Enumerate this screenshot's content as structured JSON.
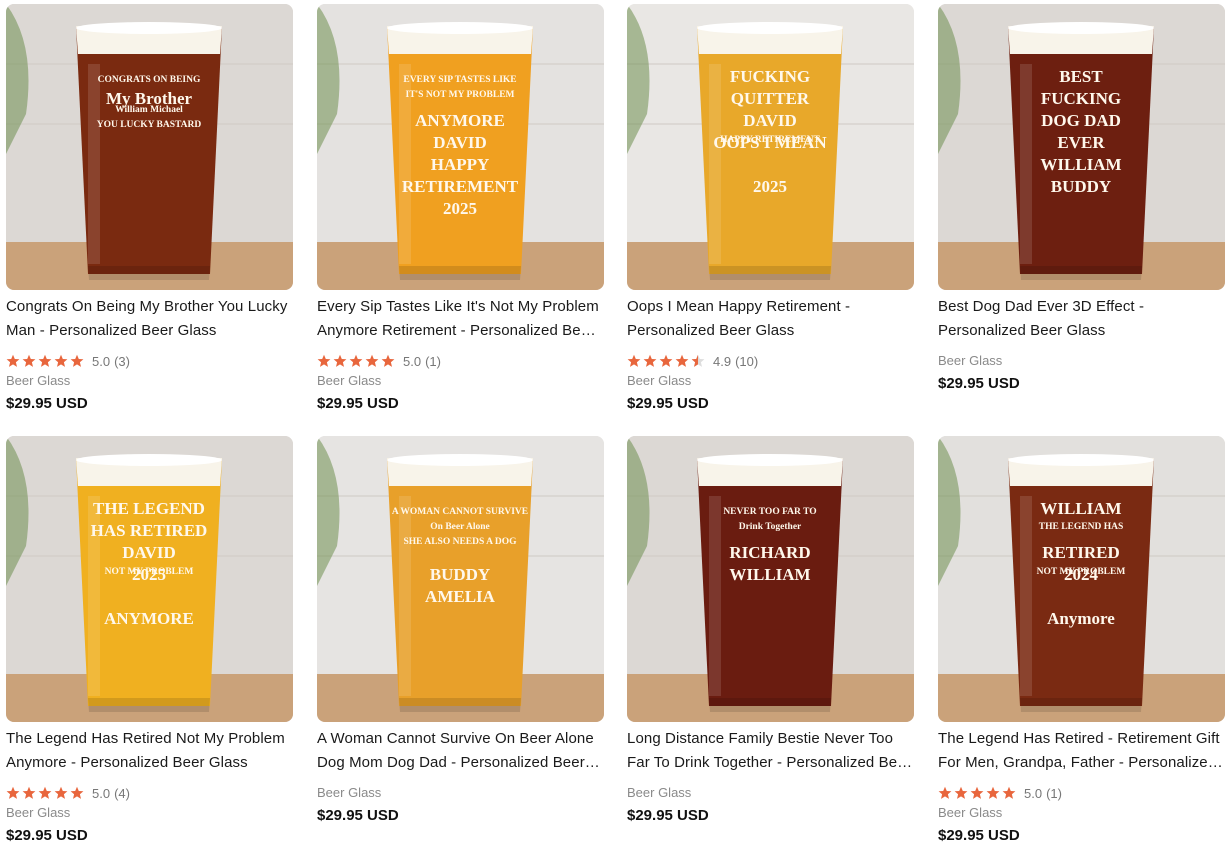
{
  "currency_suffix": "USD",
  "products": [
    {
      "title": "Congrats On Being My Brother You Lucky Man - Personalized Beer Glass",
      "rating": "5.0",
      "reviews": "(3)",
      "stars": 5,
      "category": "Beer Glass",
      "price": "$29.95 USD",
      "image": {
        "icon": "pint-glass-image",
        "beer": "#7a2a10",
        "bg": "#dcd8d4",
        "text": [
          "CONGRATS ON BEING",
          "My Brother",
          "William   Michael",
          "YOU LUCKY BASTARD"
        ]
      }
    },
    {
      "title": "Every Sip Tastes Like It's Not My Problem Anymore Retirement - Personalized Beer Glass",
      "rating": "5.0",
      "reviews": "(1)",
      "stars": 5,
      "category": "Beer Glass",
      "price": "$29.95 USD",
      "image": {
        "icon": "pint-glass-image",
        "beer": "#f0a020",
        "bg": "#e4e2e0",
        "text": [
          "EVERY SIP TASTES LIKE",
          "IT'S NOT MY PROBLEM",
          "ANYMORE",
          "DAVID",
          "HAPPY",
          "RETIREMENT",
          "2025"
        ]
      }
    },
    {
      "title": "Oops I Mean Happy Retirement - Personalized Beer Glass",
      "rating": "4.9",
      "reviews": "(10)",
      "stars": 4.5,
      "category": "Beer Glass",
      "price": "$29.95 USD",
      "image": {
        "icon": "pint-glass-image",
        "beer": "#e8a82a",
        "bg": "#e9e7e4",
        "text": [
          "FUCKING",
          "QUITTER",
          "DAVID",
          "OOPS I MEAN",
          "HAPPY RETIREMENT",
          "2025"
        ]
      }
    },
    {
      "title": "Best Dog Dad Ever 3D Effect - Personalized Beer Glass",
      "rating": "",
      "reviews": "",
      "stars": 0,
      "category": "Beer Glass",
      "price": "$29.95 USD",
      "image": {
        "icon": "pint-glass-image",
        "beer": "#6d1f10",
        "bg": "#dcd8d4",
        "text": [
          "BEST",
          "FUCKING",
          "DOG DAD",
          "EVER",
          "WILLIAM",
          "BUDDY"
        ]
      }
    },
    {
      "title": "The Legend Has Retired Not My Problem Anymore - Personalized Beer Glass",
      "rating": "5.0",
      "reviews": "(4)",
      "stars": 5,
      "category": "Beer Glass",
      "price": "$29.95 USD",
      "image": {
        "icon": "pint-glass-image",
        "beer": "#f0b020",
        "bg": "#dcd8d4",
        "text": [
          "THE LEGEND",
          "HAS RETIRED",
          "DAVID",
          "2025",
          "NOT MY PROBLEM",
          "ANYMORE"
        ]
      }
    },
    {
      "title": "A Woman Cannot Survive On Beer Alone Dog Mom Dog Dad - Personalized Beer Glass",
      "rating": "",
      "reviews": "",
      "stars": 0,
      "category": "Beer Glass",
      "price": "$29.95 USD",
      "image": {
        "icon": "pint-glass-image",
        "beer": "#e8a02a",
        "bg": "#e6e4e2",
        "text": [
          "A WOMAN CANNOT SURVIVE",
          "On Beer Alone",
          "SHE ALSO NEEDS A DOG",
          "BUDDY",
          "AMELIA"
        ]
      }
    },
    {
      "title": "Long Distance Family Bestie Never Too Far To Drink Together - Personalized Beer Glass",
      "rating": "",
      "reviews": "",
      "stars": 0,
      "category": "Beer Glass",
      "price": "$29.95 USD",
      "image": {
        "icon": "pint-glass-image",
        "beer": "#6a1c10",
        "bg": "#dcd8d4",
        "text": [
          "NEVER TOO FAR TO",
          "Drink Together",
          "RICHARD",
          "WILLIAM"
        ]
      }
    },
    {
      "title": "The Legend Has Retired - Retirement Gift For Men, Grandpa, Father - Personalized Beer Glass",
      "rating": "5.0",
      "reviews": "(1)",
      "stars": 5,
      "category": "Beer Glass",
      "price": "$29.95 USD",
      "image": {
        "icon": "pint-glass-image",
        "beer": "#7a2a12",
        "bg": "#e2e0dd",
        "text": [
          "WILLIAM",
          "THE LEGEND HAS",
          "RETIRED",
          "2024",
          "NOT MY PROBLEM",
          "Anymore"
        ]
      }
    }
  ],
  "colors": {
    "star": "#e8663d",
    "star_empty": "#dddddd"
  }
}
